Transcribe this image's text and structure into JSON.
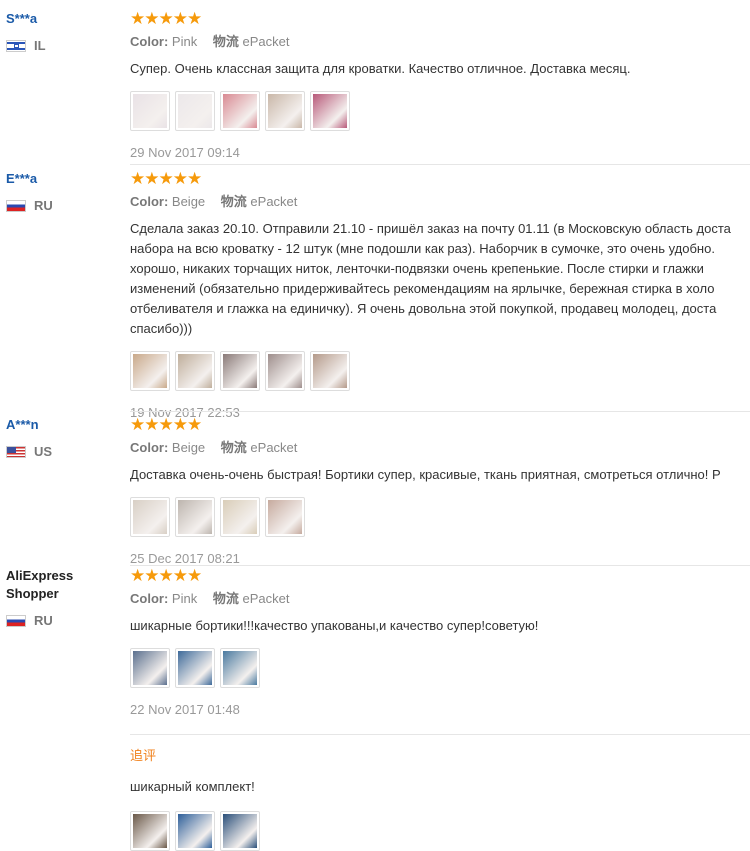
{
  "reviews": [
    {
      "user": "S***a",
      "country": "IL",
      "stars": "★★★★★",
      "color_label": "Color:",
      "color_value": "Pink",
      "ship_label": "物流",
      "ship_value": "ePacket",
      "text": [
        "Супер. Очень классная защита для кроватки. Качество отличное. Доставка месяц."
      ],
      "photo_colors": [
        "#e9e2e6",
        "#ece8ea",
        "#d98a93",
        "#c9b7a8",
        "#b85a7a"
      ],
      "date": "29 Nov 2017 09:14"
    },
    {
      "user": "E***a",
      "country": "RU",
      "stars": "★★★★★",
      "color_label": "Color:",
      "color_value": "Beige",
      "ship_label": "物流",
      "ship_value": "ePacket",
      "text": [
        "Сделала заказ 20.10. Отправили 21.10 - пришёл заказ на почту 01.11 (в Московскую область доста",
        "набора на всю кроватку - 12 штук (мне подошли как раз). Наборчик в сумочке, это очень удобно.",
        "хорошо, никаких торчащих ниток, ленточки-подвязки очень крепенькие. После стирки и глажки",
        "изменений (обязательно придерживайтесь рекомендациям на ярлычке, бережная стирка в холо",
        "отбеливателя и глажка на единичку). Я очень довольна этой покупкой, продавец молодец, доста",
        "спасибо)))"
      ],
      "photo_colors": [
        "#c9a98a",
        "#bfae9b",
        "#8a7a78",
        "#9e8e8c",
        "#b49a8a"
      ],
      "date": "19 Nov 2017 22:53"
    },
    {
      "user": "A***n",
      "country": "US",
      "stars": "★★★★★",
      "color_label": "Color:",
      "color_value": "Beige",
      "ship_label": "物流",
      "ship_value": "ePacket",
      "text": [
        "Доставка очень-очень быстрая! Бортики супер, красивые, ткань приятная, смотреться отлично! Р"
      ],
      "photo_colors": [
        "#d8cfc5",
        "#bdb5ae",
        "#d9cdb8",
        "#c6aa9e"
      ],
      "date": "25 Dec 2017 08:21"
    },
    {
      "user": "AliExpress Shopper",
      "country": "RU",
      "stars": "★★★★★",
      "color_label": "Color:",
      "color_value": "Pink",
      "ship_label": "物流",
      "ship_value": "ePacket",
      "text": [
        "шикарные бортики!!!качество упакованы,и качество супер!советую!"
      ],
      "photo_colors": [
        "#5a6f8e",
        "#3e6a9a",
        "#4a7aa0"
      ],
      "date": "22 Nov 2017 01:48",
      "followup": {
        "label": "追评",
        "text": "шикарный комплект!",
        "photo_colors": [
          "#6a5848",
          "#2e5f9a",
          "#2a4f7a"
        ]
      }
    }
  ]
}
